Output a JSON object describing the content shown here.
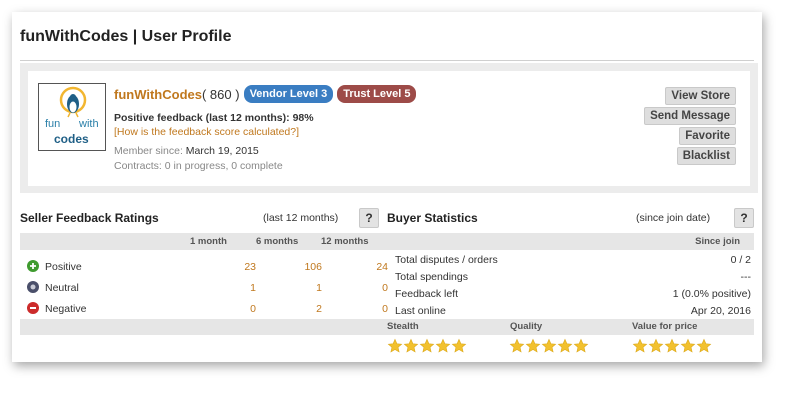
{
  "page": {
    "title": "funWithCodes | User Profile"
  },
  "vendor": {
    "name": "funWithCodes",
    "score": "( 860 )",
    "vendor_badge": "Vendor Level 3",
    "trust_badge": "Trust Level 5",
    "feedback_label": "Positive feedback (last 12 months):",
    "feedback_value": "98%",
    "feedback_link": "[How is the feedback score calculated?]",
    "member_label": "Member since:",
    "member_date": "March 19, 2015",
    "contracts": "Contracts: 0 in progress, 0 complete",
    "logo": {
      "fun": "fun",
      "with": "with",
      "codes": "codes"
    }
  },
  "actions": [
    {
      "label": "View Store"
    },
    {
      "label": "Send Message"
    },
    {
      "label": "Favorite"
    },
    {
      "label": "Blacklist"
    }
  ],
  "seller_ratings": {
    "title": "Seller Feedback Ratings",
    "period_note": "(last 12 months)",
    "help": "?",
    "columns": [
      "1 month",
      "6 months",
      "12 months"
    ],
    "rows": [
      {
        "label": "Positive",
        "icon": "plus-circle-icon",
        "values": [
          "23",
          "106",
          "24"
        ]
      },
      {
        "label": "Neutral",
        "icon": "neutral-circle-icon",
        "values": [
          "1",
          "1",
          "0"
        ]
      },
      {
        "label": "Negative",
        "icon": "minus-circle-icon",
        "values": [
          "0",
          "2",
          "0"
        ]
      }
    ]
  },
  "buyer_stats": {
    "title": "Buyer Statistics",
    "period_note": "(since join date)",
    "help": "?",
    "column": "Since join",
    "rows": [
      {
        "label": "Total disputes / orders",
        "value": "0 / 2"
      },
      {
        "label": "Total spendings",
        "value": "---"
      },
      {
        "label": "Feedback left",
        "value": "1 (0.0% positive)"
      },
      {
        "label": "Last online",
        "value": "Apr 20, 2016"
      }
    ]
  },
  "ratings": [
    {
      "label": "Stealth",
      "stars": 5
    },
    {
      "label": "Quality",
      "stars": 5
    },
    {
      "label": "Value for price",
      "stars": 5
    }
  ],
  "colors": {
    "accent_orange": "#c0781e",
    "vendor_badge": "#3a7dc2",
    "trust_badge": "#9d4b48",
    "star": "#f2c12e"
  }
}
